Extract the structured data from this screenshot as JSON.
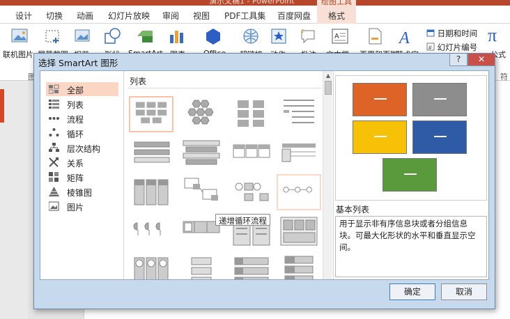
{
  "app": {
    "title": "演示文稿1 - PowerPoint"
  },
  "ribbon_tabs": [
    "设计",
    "切换",
    "动画",
    "幻灯片放映",
    "审阅",
    "视图",
    "PDF工具集",
    "百度网盘"
  ],
  "contextual": {
    "group": "绘图工具",
    "tab": "格式"
  },
  "ribbon": {
    "b1": "联机图片",
    "b2": "屏幕截图",
    "b3": "相册",
    "b4": "形状",
    "b5": "SmartArt",
    "b6": "图表",
    "b7": "Office",
    "b8": "超链接",
    "b9": "动作",
    "b10": "批注",
    "b11": "文本框",
    "b12": "页眉和页脚",
    "b13": "艺术字",
    "datetime": "日期和时间",
    "slidenum": "幻灯片编号",
    "formula": "公式",
    "pi": "π",
    "grouplabel": "图",
    "symbol": "符"
  },
  "dialog": {
    "title": "选择 SmartArt 图形",
    "help": "?",
    "close": "✕",
    "categories": [
      {
        "label": "全部",
        "icon": "all-icon"
      },
      {
        "label": "列表",
        "icon": "list-icon"
      },
      {
        "label": "流程",
        "icon": "process-icon"
      },
      {
        "label": "循环",
        "icon": "cycle-icon"
      },
      {
        "label": "层次结构",
        "icon": "hierarchy-icon"
      },
      {
        "label": "关系",
        "icon": "relationship-icon"
      },
      {
        "label": "矩阵",
        "icon": "matrix-icon"
      },
      {
        "label": "棱锥图",
        "icon": "pyramid-icon"
      },
      {
        "label": "图片",
        "icon": "picture-icon"
      }
    ],
    "selected_category": "全部",
    "gallery_heading": "列表",
    "tooltip": "递增循环流程",
    "preview_title": "基本列表",
    "description": "用于显示非有序信息块或者分组信息块。可最大化形状的水平和垂直显示空间。",
    "ok": "确定",
    "cancel": "取消",
    "preview_colors": [
      "#dd6426",
      "#8d8d8d",
      "#f6c106",
      "#2f5aa6",
      "#5a9a3c"
    ]
  }
}
